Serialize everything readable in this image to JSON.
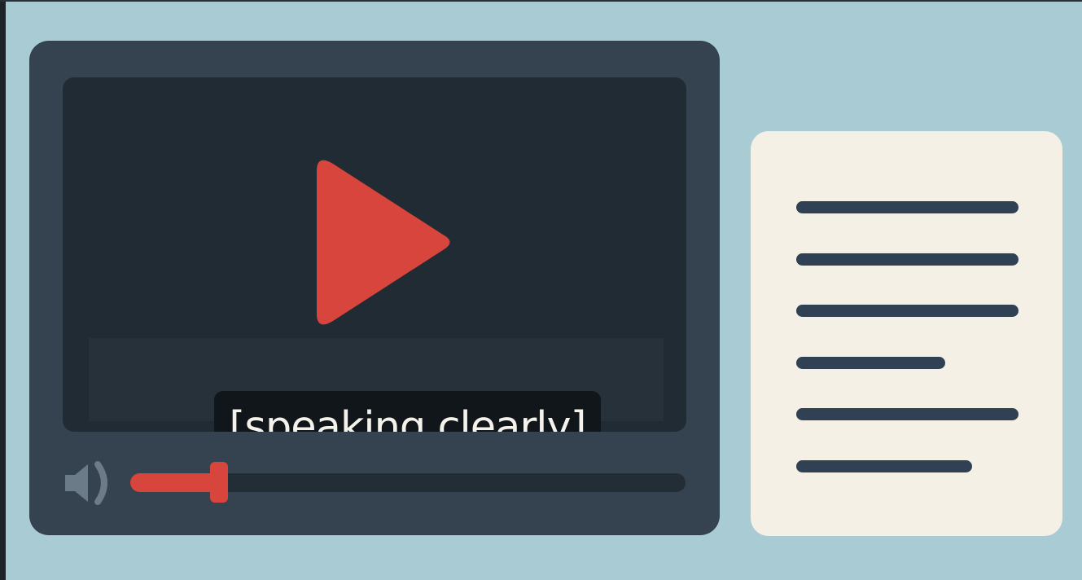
{
  "video": {
    "caption": "[speaking clearly]",
    "playback_progress": 0.16
  },
  "icons": {
    "play": "play-icon",
    "volume": "speaker-volume-icon"
  },
  "transcript": {
    "lines": [
      {
        "length": 1.0
      },
      {
        "length": 1.0
      },
      {
        "length": 1.0
      },
      {
        "length": 0.67
      },
      {
        "length": 1.0
      },
      {
        "length": 0.79
      }
    ]
  },
  "colors": {
    "background": "#a9cbd3",
    "player": "#34434f",
    "screen": "#212b34",
    "accent": "#d8453c",
    "caption_bg": "#11161a",
    "caption_text": "#f4f2ea",
    "panel": "#f5f0e5",
    "text_line": "#2f4152"
  }
}
